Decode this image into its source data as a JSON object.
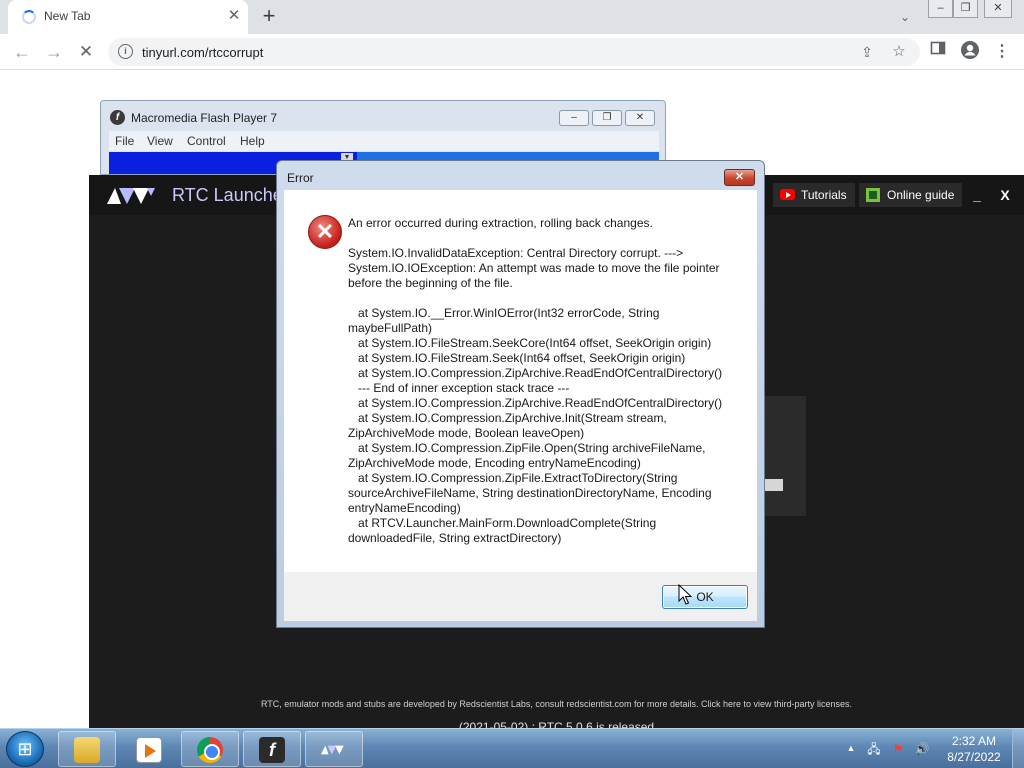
{
  "browser": {
    "tab": {
      "title": "New Tab"
    },
    "address": "tinyurl.com/rtccorrupt"
  },
  "flash_window": {
    "title": "Macromedia Flash Player 7",
    "menu": [
      "File",
      "View",
      "Control",
      "Help"
    ]
  },
  "rtc": {
    "title": "RTC Launcher",
    "tutorials_label": "Tutorials",
    "guide_label": "Online guide",
    "min_label": "_",
    "close_label": "X",
    "footer": "RTC, emulator mods and stubs are developed by Redscientist Labs, consult redscientist.com for more details. Click here to view third-party licenses.",
    "news": "(2021-05-02) : RTC 5.0.6 is released"
  },
  "dialog": {
    "title": "Error",
    "close_label": "✕",
    "summary": "An error occurred during extraction, rolling back changes.",
    "detail": "System.IO.InvalidDataException: Central Directory corrupt. --->\nSystem.IO.IOException: An attempt was made to move the file pointer\nbefore the beginning of the file.\n\n   at System.IO.__Error.WinIOError(Int32 errorCode, String\nmaybeFullPath)\n   at System.IO.FileStream.SeekCore(Int64 offset, SeekOrigin origin)\n   at System.IO.FileStream.Seek(Int64 offset, SeekOrigin origin)\n   at System.IO.Compression.ZipArchive.ReadEndOfCentralDirectory()\n   --- End of inner exception stack trace ---\n   at System.IO.Compression.ZipArchive.ReadEndOfCentralDirectory()\n   at System.IO.Compression.ZipArchive.Init(Stream stream,\nZipArchiveMode mode, Boolean leaveOpen)\n   at System.IO.Compression.ZipFile.Open(String archiveFileName,\nZipArchiveMode mode, Encoding entryNameEncoding)\n   at System.IO.Compression.ZipFile.ExtractToDirectory(String\nsourceArchiveFileName, String destinationDirectoryName, Encoding\nentryNameEncoding)\n   at RTCV.Launcher.MainForm.DownloadComplete(String\ndownloadedFile, String extractDirectory)",
    "ok_label": "OK"
  },
  "taskbar": {
    "time": "2:32 AM",
    "date": "8/27/2022",
    "apps": [
      "explorer-icon",
      "media-player-icon",
      "chrome-icon",
      "flash-player-icon",
      "rtc-launcher-icon"
    ]
  },
  "colors": {
    "error_red": "#c8231c",
    "rtc_background": "#1c1c1c",
    "flash_blue": "#0a1fe0"
  }
}
